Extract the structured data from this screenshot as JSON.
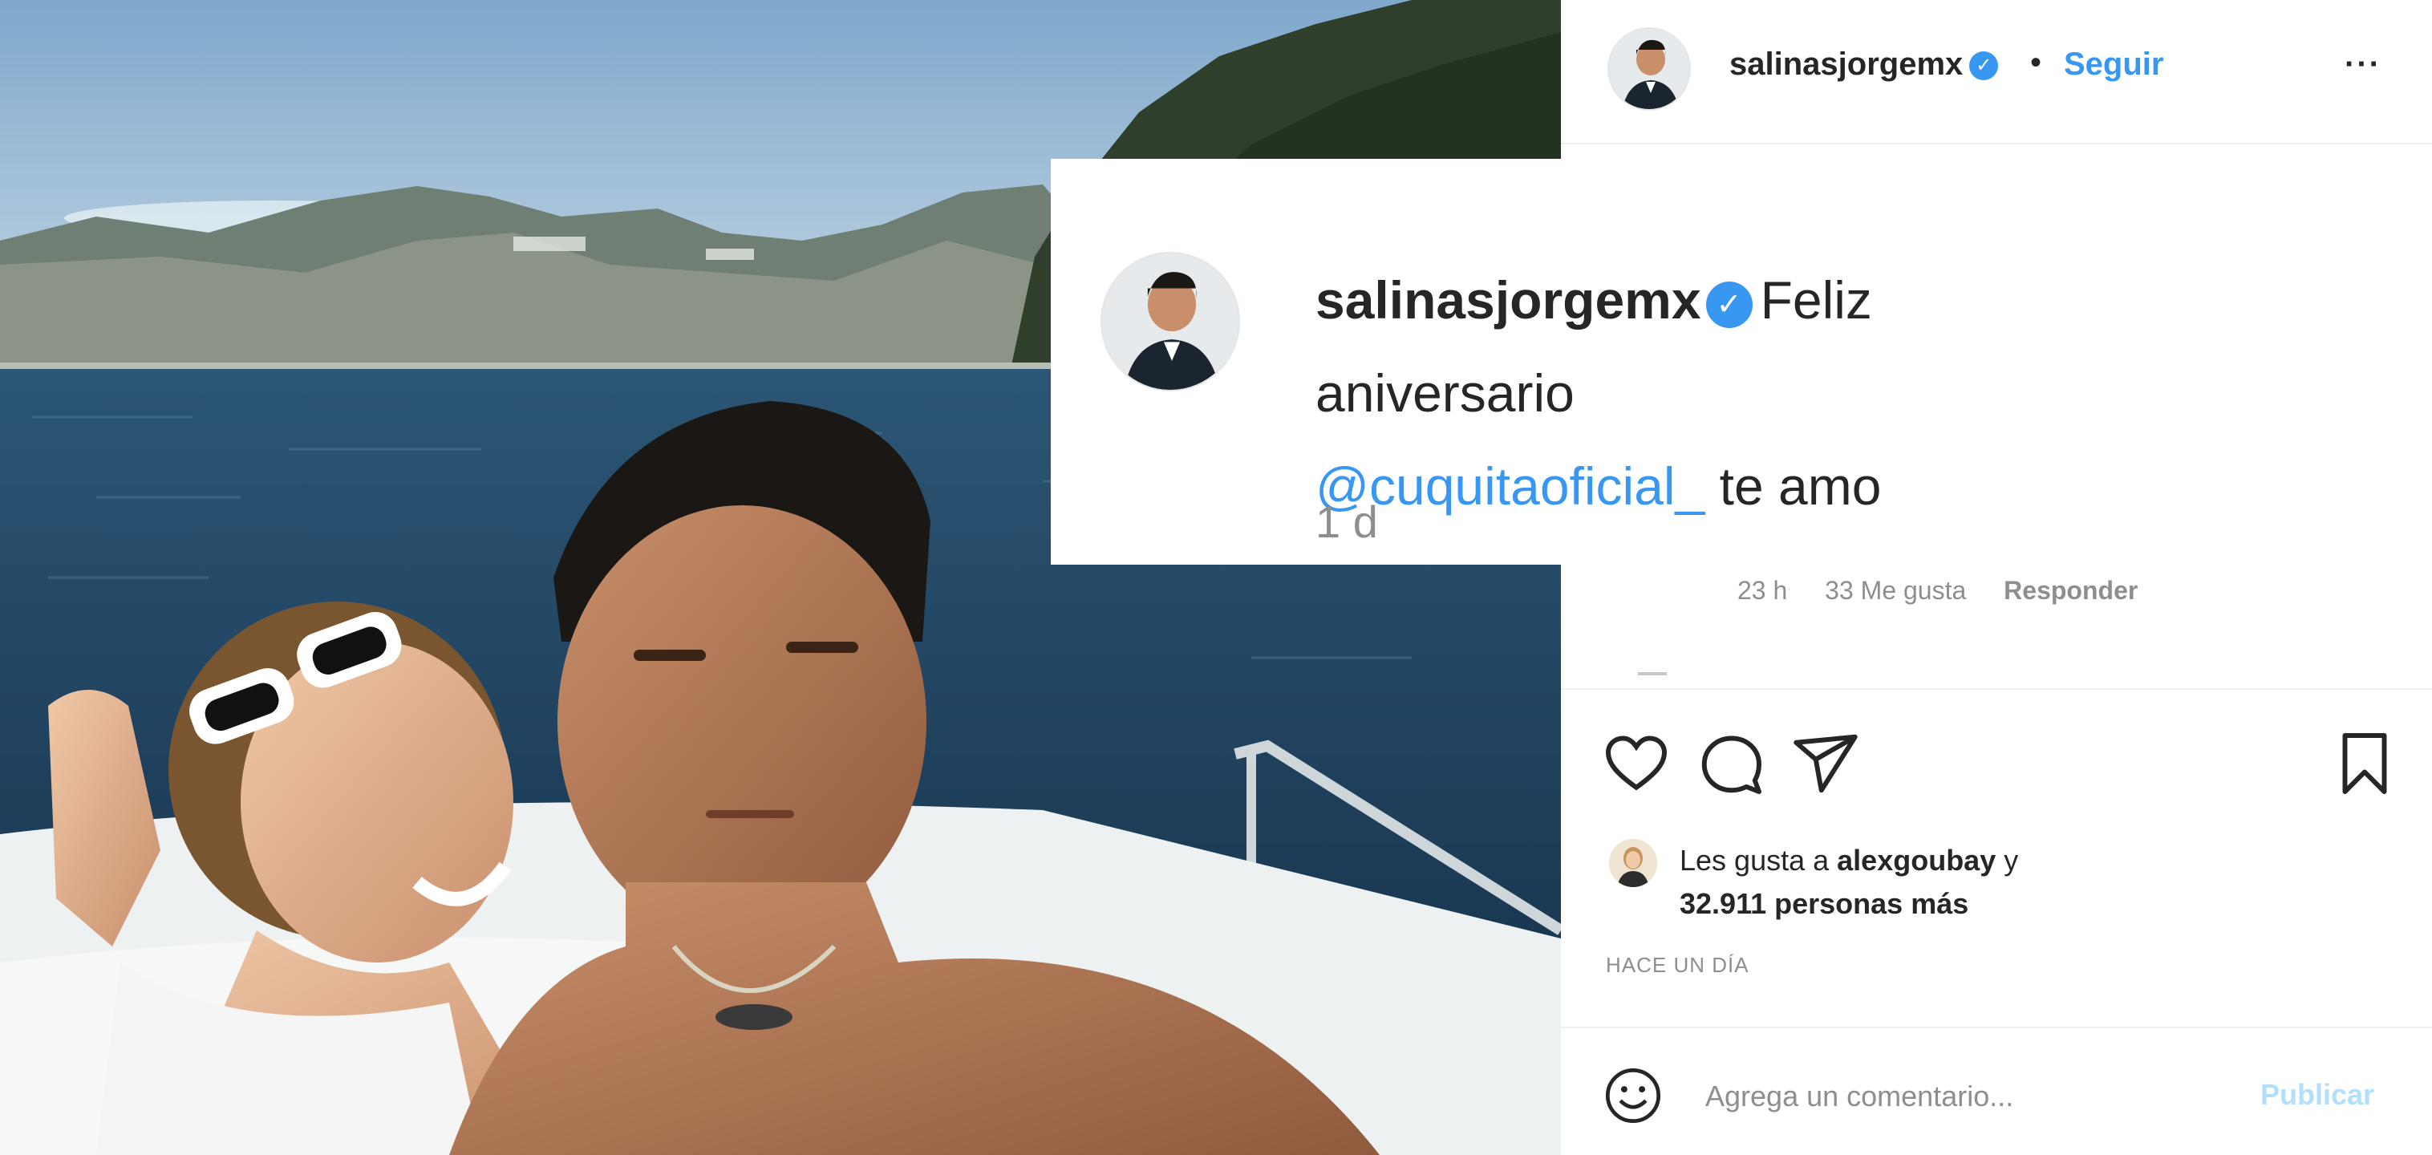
{
  "post": {
    "username": "salinasjorgemx",
    "verified_glyph": "✓",
    "separator": "•",
    "follow_label": "Seguir",
    "more_label": "···"
  },
  "caption": {
    "username": "salinasjorgemx",
    "verified_glyph": "✓",
    "text": "Feliz aniversario",
    "mention": "@cuquitaoficial_",
    "tail": "te amo",
    "time": "1 d"
  },
  "reply_meta": {
    "time": "23 h",
    "likes": "33 Me gusta",
    "reply_label": "Responder"
  },
  "actions": {
    "like_icon": "heart-icon",
    "comment_icon": "comment-icon",
    "share_icon": "paper-plane-icon",
    "save_icon": "bookmark-icon"
  },
  "likes": {
    "prefix": "Les gusta a",
    "user": "alexgoubay",
    "conj": "y",
    "count": "32.911 personas más"
  },
  "posted": "HACE UN DÍA",
  "comment_box": {
    "placeholder": "Agrega un comentario...",
    "publish_label": "Publicar"
  },
  "colors": {
    "accent": "#3897f0",
    "publish_disabled": "#b2dffc",
    "muted": "#8e8e8e",
    "text": "#262626"
  }
}
